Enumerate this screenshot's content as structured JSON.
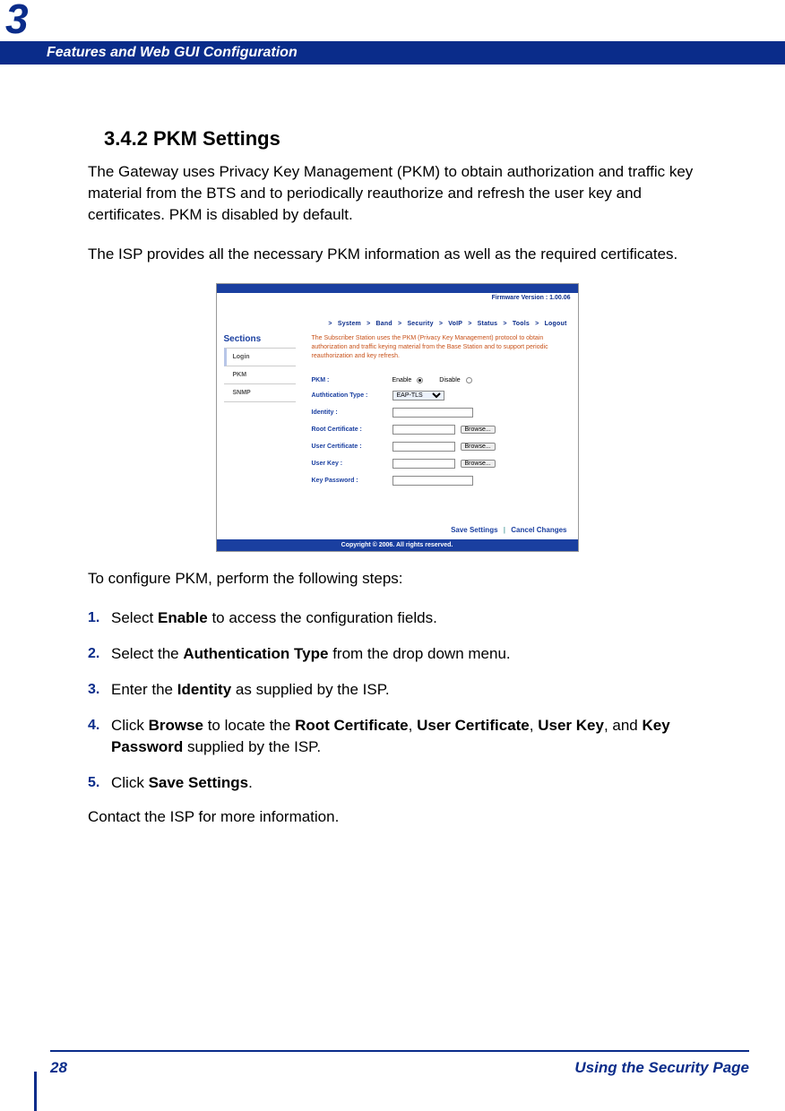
{
  "header": {
    "chapter_number": "3",
    "title": "Features and Web GUI Configuration"
  },
  "section": {
    "heading": "3.4.2 PKM Settings",
    "para1": "The Gateway uses Privacy Key Management (PKM) to obtain authorization and traffic key material from the BTS and to periodically reauthorize and refresh the user key and certificates. PKM is disabled by default.",
    "para2": "The ISP provides all the necessary PKM information as well as the required certificates.",
    "steps_intro": "To configure PKM, perform the following steps:",
    "steps": [
      {
        "num": "1.",
        "pre": "Select ",
        "b1": "Enable",
        "post": " to access the configuration fields."
      },
      {
        "num": "2.",
        "pre": "Select the ",
        "b1": "Authentication Type",
        "post": " from the drop down menu."
      },
      {
        "num": "3.",
        "pre": "Enter the ",
        "b1": "Identity",
        "post": " as supplied by the ISP."
      },
      {
        "num": "4.",
        "pre": "Click ",
        "b1": "Browse",
        "mid1": " to locate the ",
        "b2": "Root Certificate",
        "mid2": ", ",
        "b3": "User Certificate",
        "mid3": ", ",
        "b4": "User Key",
        "mid4": ", and ",
        "b5": "Key Password",
        "post": " supplied by the ISP."
      },
      {
        "num": "5.",
        "pre": "Click ",
        "b1": "Save Settings",
        "post": "."
      }
    ],
    "closing": "Contact the ISP for more information."
  },
  "screenshot": {
    "firmware": "Firmware Version : 1.00.06",
    "nav": [
      "System",
      "Band",
      "Security",
      "VoIP",
      "Status",
      "Tools",
      "Logout"
    ],
    "sections_title": "Sections",
    "side_items": [
      "Login",
      "PKM",
      "SNMP"
    ],
    "desc": "The Subscriber Station uses the PKM (Privacy Key Management) protocol to obtain authorization and traffic keying material from the Base Station and to support periodic reauthorization and key refresh.",
    "labels": {
      "pkm": "PKM :",
      "auth": "Authtication Type :",
      "identity": "Identity :",
      "root": "Root Certificate :",
      "user_cert": "User Certificate :",
      "user_key": "User Key :",
      "key_pw": "Key Password :"
    },
    "enable": "Enable",
    "disable": "Disable",
    "auth_value": "EAP-TLS",
    "browse": "Browse...",
    "save": "Save Settings",
    "cancel": "Cancel Changes",
    "copyright": "Copyright © 2006.  All rights reserved."
  },
  "footer": {
    "page": "28",
    "title": "Using the Security Page"
  }
}
